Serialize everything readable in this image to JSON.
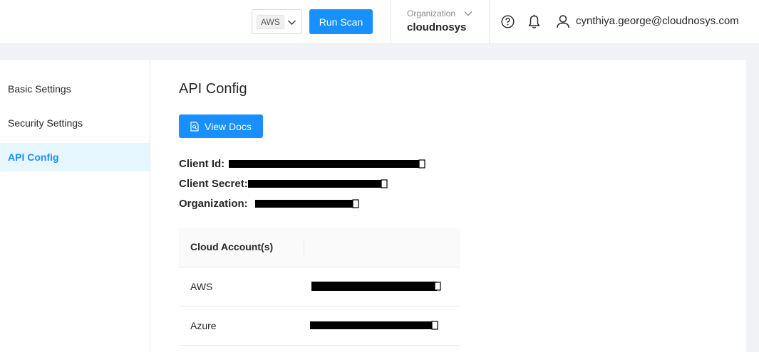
{
  "header": {
    "cloud_select_value": "AWS",
    "run_scan_label": "Run Scan",
    "organization_label": "Organization",
    "organization_name": "cloudnosys",
    "user_email": "cynthiya.george@cloudnosys.com",
    "icons": [
      "chevron-down-icon",
      "help-circle-icon",
      "bell-icon",
      "user-icon"
    ]
  },
  "sidebar": {
    "items": [
      {
        "label": "Basic Settings",
        "active": false
      },
      {
        "label": "Security Settings",
        "active": false
      },
      {
        "label": "API Config",
        "active": true
      }
    ]
  },
  "main": {
    "title": "API Config",
    "view_docs_label": "View Docs",
    "fields": [
      {
        "label": "Client Id:",
        "value_state": "redacted"
      },
      {
        "label": "Client Secret:",
        "value_state": "redacted"
      },
      {
        "label": "Organization:",
        "value_state": "redacted"
      }
    ],
    "table": {
      "headers": [
        "Cloud Account(s)",
        ""
      ],
      "rows": [
        {
          "account": "AWS",
          "value_state": "redacted"
        },
        {
          "account": "Azure",
          "value_state": "redacted"
        }
      ]
    }
  },
  "colors": {
    "primary": "#1890ff",
    "active_bg": "#e6f7ff",
    "page_bg": "#f0f2f5",
    "redaction": "#000000"
  }
}
